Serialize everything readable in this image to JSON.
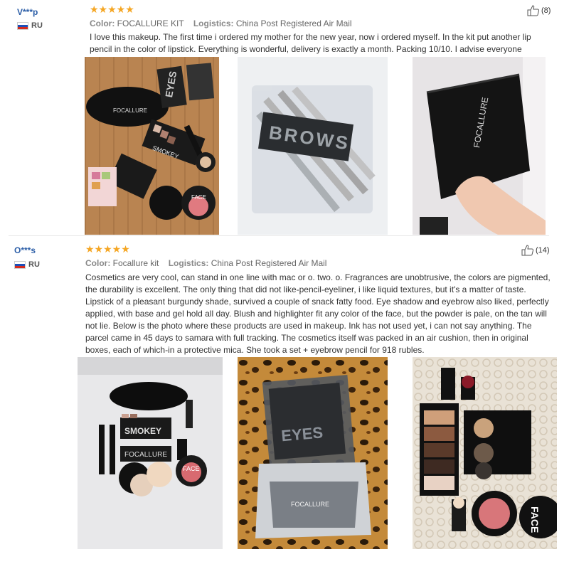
{
  "reviews": [
    {
      "user": "V***p",
      "country": "RU",
      "stars": "★★★★★",
      "color_label": "Color:",
      "color_value": "FOCALLURE KIT",
      "logistics_label": "Logistics:",
      "logistics_value": "China Post Registered Air Mail",
      "helpful_count": "(8)",
      "text": "I love this makeup. The first time i ordered my mother for the new year, now i ordered myself. In the kit put another lip pencil in the color of lipstick. Everything is wonderful, delivery is exactly a month. Packing 10/10. I advise everyone",
      "photos": [
        {
          "caption_a": "EYES",
          "caption_b": "FOCALLURE",
          "caption_c": "SMOKEY",
          "caption_d": "FACE"
        },
        {
          "caption_a": "BROWS"
        },
        {
          "caption_a": "FOCALLURE"
        }
      ]
    },
    {
      "user": "O***s",
      "country": "RU",
      "stars": "★★★★★",
      "color_label": "Color:",
      "color_value": "Focallure kit",
      "logistics_label": "Logistics:",
      "logistics_value": "China Post Registered Air Mail",
      "helpful_count": "(14)",
      "text": "Cosmetics are very cool, can stand in one line with mac or o. two. o. Fragrances are unobtrusive, the colors are pigmented, the durability is excellent. The only thing that did not like-pencil-eyeliner, i like liquid textures, but it's a matter of taste. Lipstick of a pleasant burgundy shade, survived a couple of snack fatty food. Eye shadow and eyebrow also liked, perfectly applied, with base and gel hold all day. Blush and highlighter fit any color of the face, but the powder is pale, on the tan will not lie. Below is the photo where these products are used in makeup. Ink has not used yet, i can not say anything. The parcel came in 45 days to samara with full tracking. The cosmetics itself was packed in an air cushion, then in original boxes, each of which-in a protective mica. She took a set + eyebrow pencil for 918 rubles.",
      "photos": [
        {
          "caption_a": "SMOKEY",
          "caption_b": "FOCALLURE",
          "caption_c": "FACE"
        },
        {
          "caption_a": "EYES",
          "caption_b": "FOCALLURE"
        },
        {
          "caption_a": "FACE"
        }
      ]
    }
  ],
  "colors": {
    "star": "#f5a623",
    "username": "#2d5fa8",
    "divider": "#e6e6e6"
  },
  "icons": {
    "helpful": "thumbs-up-icon",
    "flag": "russia-flag-icon"
  }
}
